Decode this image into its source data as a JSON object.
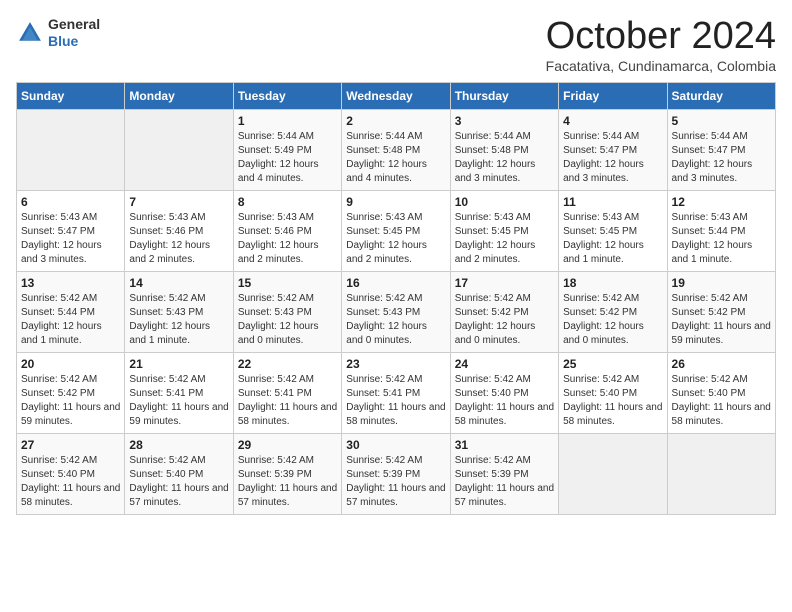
{
  "logo": {
    "general": "General",
    "blue": "Blue"
  },
  "title": "October 2024",
  "location": "Facatativa, Cundinamarca, Colombia",
  "days_of_week": [
    "Sunday",
    "Monday",
    "Tuesday",
    "Wednesday",
    "Thursday",
    "Friday",
    "Saturday"
  ],
  "weeks": [
    [
      {
        "day": "",
        "sunrise": "",
        "sunset": "",
        "daylight": ""
      },
      {
        "day": "",
        "sunrise": "",
        "sunset": "",
        "daylight": ""
      },
      {
        "day": "1",
        "sunrise": "Sunrise: 5:44 AM",
        "sunset": "Sunset: 5:49 PM",
        "daylight": "Daylight: 12 hours and 4 minutes."
      },
      {
        "day": "2",
        "sunrise": "Sunrise: 5:44 AM",
        "sunset": "Sunset: 5:48 PM",
        "daylight": "Daylight: 12 hours and 4 minutes."
      },
      {
        "day": "3",
        "sunrise": "Sunrise: 5:44 AM",
        "sunset": "Sunset: 5:48 PM",
        "daylight": "Daylight: 12 hours and 3 minutes."
      },
      {
        "day": "4",
        "sunrise": "Sunrise: 5:44 AM",
        "sunset": "Sunset: 5:47 PM",
        "daylight": "Daylight: 12 hours and 3 minutes."
      },
      {
        "day": "5",
        "sunrise": "Sunrise: 5:44 AM",
        "sunset": "Sunset: 5:47 PM",
        "daylight": "Daylight: 12 hours and 3 minutes."
      }
    ],
    [
      {
        "day": "6",
        "sunrise": "Sunrise: 5:43 AM",
        "sunset": "Sunset: 5:47 PM",
        "daylight": "Daylight: 12 hours and 3 minutes."
      },
      {
        "day": "7",
        "sunrise": "Sunrise: 5:43 AM",
        "sunset": "Sunset: 5:46 PM",
        "daylight": "Daylight: 12 hours and 2 minutes."
      },
      {
        "day": "8",
        "sunrise": "Sunrise: 5:43 AM",
        "sunset": "Sunset: 5:46 PM",
        "daylight": "Daylight: 12 hours and 2 minutes."
      },
      {
        "day": "9",
        "sunrise": "Sunrise: 5:43 AM",
        "sunset": "Sunset: 5:45 PM",
        "daylight": "Daylight: 12 hours and 2 minutes."
      },
      {
        "day": "10",
        "sunrise": "Sunrise: 5:43 AM",
        "sunset": "Sunset: 5:45 PM",
        "daylight": "Daylight: 12 hours and 2 minutes."
      },
      {
        "day": "11",
        "sunrise": "Sunrise: 5:43 AM",
        "sunset": "Sunset: 5:45 PM",
        "daylight": "Daylight: 12 hours and 1 minute."
      },
      {
        "day": "12",
        "sunrise": "Sunrise: 5:43 AM",
        "sunset": "Sunset: 5:44 PM",
        "daylight": "Daylight: 12 hours and 1 minute."
      }
    ],
    [
      {
        "day": "13",
        "sunrise": "Sunrise: 5:42 AM",
        "sunset": "Sunset: 5:44 PM",
        "daylight": "Daylight: 12 hours and 1 minute."
      },
      {
        "day": "14",
        "sunrise": "Sunrise: 5:42 AM",
        "sunset": "Sunset: 5:43 PM",
        "daylight": "Daylight: 12 hours and 1 minute."
      },
      {
        "day": "15",
        "sunrise": "Sunrise: 5:42 AM",
        "sunset": "Sunset: 5:43 PM",
        "daylight": "Daylight: 12 hours and 0 minutes."
      },
      {
        "day": "16",
        "sunrise": "Sunrise: 5:42 AM",
        "sunset": "Sunset: 5:43 PM",
        "daylight": "Daylight: 12 hours and 0 minutes."
      },
      {
        "day": "17",
        "sunrise": "Sunrise: 5:42 AM",
        "sunset": "Sunset: 5:42 PM",
        "daylight": "Daylight: 12 hours and 0 minutes."
      },
      {
        "day": "18",
        "sunrise": "Sunrise: 5:42 AM",
        "sunset": "Sunset: 5:42 PM",
        "daylight": "Daylight: 12 hours and 0 minutes."
      },
      {
        "day": "19",
        "sunrise": "Sunrise: 5:42 AM",
        "sunset": "Sunset: 5:42 PM",
        "daylight": "Daylight: 11 hours and 59 minutes."
      }
    ],
    [
      {
        "day": "20",
        "sunrise": "Sunrise: 5:42 AM",
        "sunset": "Sunset: 5:42 PM",
        "daylight": "Daylight: 11 hours and 59 minutes."
      },
      {
        "day": "21",
        "sunrise": "Sunrise: 5:42 AM",
        "sunset": "Sunset: 5:41 PM",
        "daylight": "Daylight: 11 hours and 59 minutes."
      },
      {
        "day": "22",
        "sunrise": "Sunrise: 5:42 AM",
        "sunset": "Sunset: 5:41 PM",
        "daylight": "Daylight: 11 hours and 58 minutes."
      },
      {
        "day": "23",
        "sunrise": "Sunrise: 5:42 AM",
        "sunset": "Sunset: 5:41 PM",
        "daylight": "Daylight: 11 hours and 58 minutes."
      },
      {
        "day": "24",
        "sunrise": "Sunrise: 5:42 AM",
        "sunset": "Sunset: 5:40 PM",
        "daylight": "Daylight: 11 hours and 58 minutes."
      },
      {
        "day": "25",
        "sunrise": "Sunrise: 5:42 AM",
        "sunset": "Sunset: 5:40 PM",
        "daylight": "Daylight: 11 hours and 58 minutes."
      },
      {
        "day": "26",
        "sunrise": "Sunrise: 5:42 AM",
        "sunset": "Sunset: 5:40 PM",
        "daylight": "Daylight: 11 hours and 58 minutes."
      }
    ],
    [
      {
        "day": "27",
        "sunrise": "Sunrise: 5:42 AM",
        "sunset": "Sunset: 5:40 PM",
        "daylight": "Daylight: 11 hours and 58 minutes."
      },
      {
        "day": "28",
        "sunrise": "Sunrise: 5:42 AM",
        "sunset": "Sunset: 5:40 PM",
        "daylight": "Daylight: 11 hours and 57 minutes."
      },
      {
        "day": "29",
        "sunrise": "Sunrise: 5:42 AM",
        "sunset": "Sunset: 5:39 PM",
        "daylight": "Daylight: 11 hours and 57 minutes."
      },
      {
        "day": "30",
        "sunrise": "Sunrise: 5:42 AM",
        "sunset": "Sunset: 5:39 PM",
        "daylight": "Daylight: 11 hours and 57 minutes."
      },
      {
        "day": "31",
        "sunrise": "Sunrise: 5:42 AM",
        "sunset": "Sunset: 5:39 PM",
        "daylight": "Daylight: 11 hours and 57 minutes."
      },
      {
        "day": "",
        "sunrise": "",
        "sunset": "",
        "daylight": ""
      },
      {
        "day": "",
        "sunrise": "",
        "sunset": "",
        "daylight": ""
      }
    ]
  ]
}
